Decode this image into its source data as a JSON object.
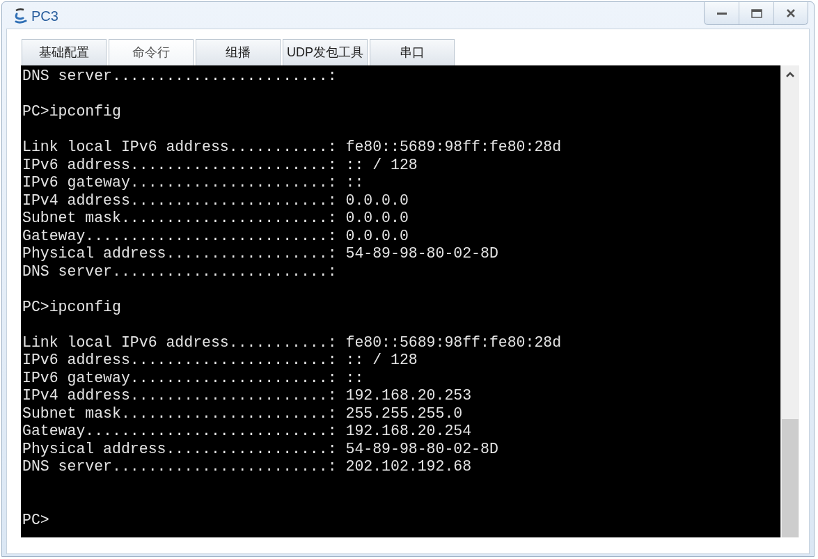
{
  "window": {
    "title": "PC3"
  },
  "tabs": [
    {
      "label": "基础配置",
      "selected": false
    },
    {
      "label": "命令行",
      "selected": true
    },
    {
      "label": "组播",
      "selected": false
    },
    {
      "label": "UDP发包工具",
      "selected": false
    },
    {
      "label": "串口",
      "selected": false
    }
  ],
  "terminal": {
    "blocks": [
      {
        "lines": [
          "DNS server........................:"
        ]
      },
      {
        "lines": [
          "PC>ipconfig"
        ]
      },
      {
        "lines": [
          "Link local IPv6 address...........: fe80::5689:98ff:fe80:28d",
          "IPv6 address......................: :: / 128",
          "IPv6 gateway......................: ::",
          "IPv4 address......................: 0.0.0.0",
          "Subnet mask.......................: 0.0.0.0",
          "Gateway...........................: 0.0.0.0",
          "Physical address..................: 54-89-98-80-02-8D",
          "DNS server........................:"
        ]
      },
      {
        "lines": [
          "PC>ipconfig"
        ]
      },
      {
        "lines": [
          "Link local IPv6 address...........: fe80::5689:98ff:fe80:28d",
          "IPv6 address......................: :: / 128",
          "IPv6 gateway......................: ::",
          "IPv4 address......................: 192.168.20.253",
          "Subnet mask.......................: 255.255.255.0",
          "Gateway...........................: 192.168.20.254",
          "Physical address..................: 54-89-98-80-02-8D",
          "DNS server........................: 202.102.192.68"
        ]
      },
      {
        "lines": [
          "PC>"
        ]
      }
    ]
  }
}
